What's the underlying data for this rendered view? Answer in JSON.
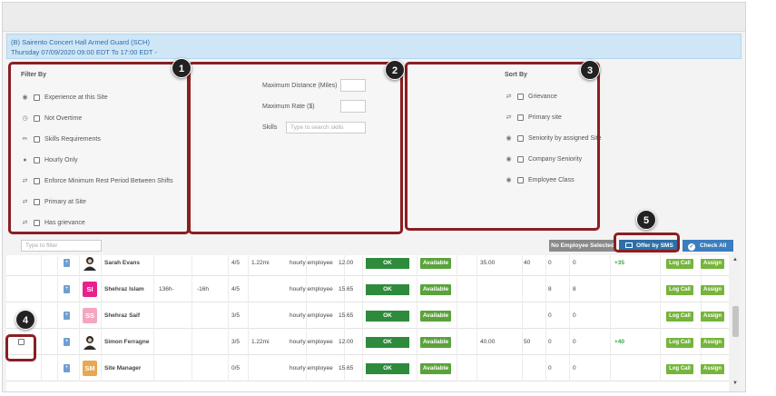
{
  "banner": {
    "line1": "(B) Sairento Concert Hall Armed Guard (SCH)",
    "line2": "Thursday 07/09/2020 09:00 EDT To 17:00 EDT -"
  },
  "filter_by": {
    "title": "Filter By",
    "items": [
      {
        "label": "Experience at this Site",
        "icon": "medal-icon"
      },
      {
        "label": "Not Overtime",
        "icon": "clock-icon"
      },
      {
        "label": "Skills Requirements",
        "icon": "wrench-icon"
      },
      {
        "label": "Hourly Only",
        "icon": "person-icon"
      },
      {
        "label": "Enforce Minimum Rest Period Between Shifts",
        "icon": "swap-icon"
      },
      {
        "label": "Primary at Site",
        "icon": "swap-icon"
      },
      {
        "label": "Has grievance",
        "icon": "swap-icon"
      }
    ]
  },
  "middle": {
    "max_distance": "Maximum Distance (Miles)",
    "max_rate": "Maximum Rate ($)",
    "skills": "Skills",
    "skills_placeholder": "Type to search skills"
  },
  "sort_by": {
    "title": "Sort By",
    "items": [
      {
        "label": "Grievance",
        "icon": "swap-icon"
      },
      {
        "label": "Primary site",
        "icon": "swap-icon"
      },
      {
        "label": "Seniority by assigned Site",
        "icon": "medal-icon"
      },
      {
        "label": "Company Seniority",
        "icon": "medal-icon"
      },
      {
        "label": "Employee Class",
        "icon": "medal-icon"
      }
    ]
  },
  "toolbar": {
    "filter_placeholder": "Type to filter",
    "no_employee": "No Employee Selected",
    "offer_sms": "Offer by SMS",
    "check_all": "Check All"
  },
  "callouts": [
    "1",
    "2",
    "3",
    "4",
    "5"
  ],
  "colors": {
    "callout_border": "#8a1f22",
    "banner_bg": "#cfe6f7",
    "ok_green": "#2e8b3b",
    "avail_green": "#5aa33b",
    "btn_green": "#76b43b",
    "sms_blue": "#2e6fa8"
  },
  "rows": [
    {
      "avatar": "",
      "avatar_type": "photo",
      "avatar_color": "#ffffff",
      "name": "Sarah Evans",
      "c1": "",
      "c2": "",
      "ratio": "4/5",
      "dist": "1.22mi",
      "type": "hourly employee",
      "rate": "12.00",
      "status": "OK",
      "avail": "Available",
      "hours": "35.00",
      "h2": "40",
      "a": "0",
      "b": "0",
      "diff": "+35",
      "log": "Log Call",
      "assign": "Assign"
    },
    {
      "avatar": "SI",
      "avatar_type": "initials",
      "avatar_color": "#e8218f",
      "name": "Shehraz Islam",
      "c1": "136h-",
      "c2": "-16h",
      "ratio": "4/5",
      "dist": "",
      "type": "hourly employee",
      "rate": "15.65",
      "status": "OK",
      "avail": "Available",
      "hours": "",
      "h2": "",
      "a": "8",
      "b": "8",
      "diff": "",
      "log": "Log Call",
      "assign": "Assign"
    },
    {
      "avatar": "SS",
      "avatar_type": "initials",
      "avatar_color": "#f4a6c0",
      "name": "Shehraz Saif",
      "c1": "",
      "c2": "",
      "ratio": "3/5",
      "dist": "",
      "type": "hourly employee",
      "rate": "15.65",
      "status": "OK",
      "avail": "Available",
      "hours": "",
      "h2": "",
      "a": "0",
      "b": "0",
      "diff": "",
      "log": "Log Call",
      "assign": "Assign"
    },
    {
      "avatar": "",
      "avatar_type": "photo",
      "avatar_color": "#ffffff",
      "name": "Simon Ferragne",
      "c1": "",
      "c2": "",
      "ratio": "3/5",
      "dist": "1.22mi",
      "type": "hourly employee",
      "rate": "12.00",
      "status": "OK",
      "avail": "Available",
      "hours": "40.00",
      "h2": "50",
      "a": "0",
      "b": "0",
      "diff": "+40",
      "log": "Log Call",
      "assign": "Assign"
    },
    {
      "avatar": "SM",
      "avatar_type": "initials",
      "avatar_color": "#e9a74f",
      "name": "Site Manager",
      "c1": "",
      "c2": "",
      "ratio": "0/5",
      "dist": "",
      "type": "hourly employee",
      "rate": "15.65",
      "status": "OK",
      "avail": "Available",
      "hours": "",
      "h2": "",
      "a": "0",
      "b": "0",
      "diff": "",
      "log": "Log Call",
      "assign": "Assign"
    }
  ]
}
